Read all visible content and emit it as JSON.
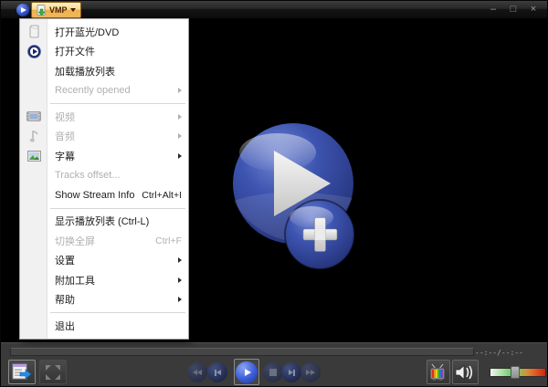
{
  "window": {
    "menu_button_label": "VMP",
    "controls": {
      "minimize": "–",
      "maximize": "□",
      "close": "×"
    }
  },
  "menu": {
    "items": [
      {
        "label": "打开蓝光/DVD",
        "icon": "disc-icon",
        "enabled": true
      },
      {
        "label": "打开文件",
        "icon": "play-circle-icon",
        "enabled": true
      },
      {
        "label": "加载播放列表",
        "enabled": true
      },
      {
        "label": "Recently opened",
        "enabled": false,
        "submenu": true
      },
      {
        "label": "视频",
        "icon": "film-icon",
        "enabled": false,
        "submenu": true
      },
      {
        "label": "音频",
        "icon": "music-note-icon",
        "enabled": false,
        "submenu": true
      },
      {
        "label": "字幕",
        "icon": "image-icon",
        "enabled": true,
        "submenu": true
      },
      {
        "label": "Tracks offset...",
        "enabled": false
      },
      {
        "label": "Show Stream Info",
        "shortcut": "Ctrl+Alt+I",
        "enabled": true
      },
      {
        "label": "显示播放列表 (Ctrl-L)",
        "enabled": true
      },
      {
        "label": "切换全屏",
        "shortcut": "Ctrl+F",
        "enabled": false
      },
      {
        "label": "设置",
        "enabled": true,
        "submenu": true
      },
      {
        "label": "附加工具",
        "enabled": true,
        "submenu": true
      },
      {
        "label": "帮助",
        "enabled": true,
        "submenu": true
      },
      {
        "label": "退出",
        "enabled": true
      }
    ]
  },
  "transport": {
    "left_buttons": [
      "playlist",
      "fullscreen"
    ],
    "buttons": [
      "rewind",
      "previous",
      "play",
      "stop",
      "next",
      "fast-forward"
    ],
    "right_buttons": [
      "tv-channels",
      "mute-volume"
    ],
    "volume_thumb_position": 0.42
  },
  "status": {
    "time_display": "--:--/--:--"
  },
  "colors": {
    "accent_amber": "#F3BD62",
    "logo_blue": "#3D54B0",
    "play_button_blue": "#3A5CD8",
    "volume_green": "#62C860",
    "volume_red": "#CC2810"
  }
}
